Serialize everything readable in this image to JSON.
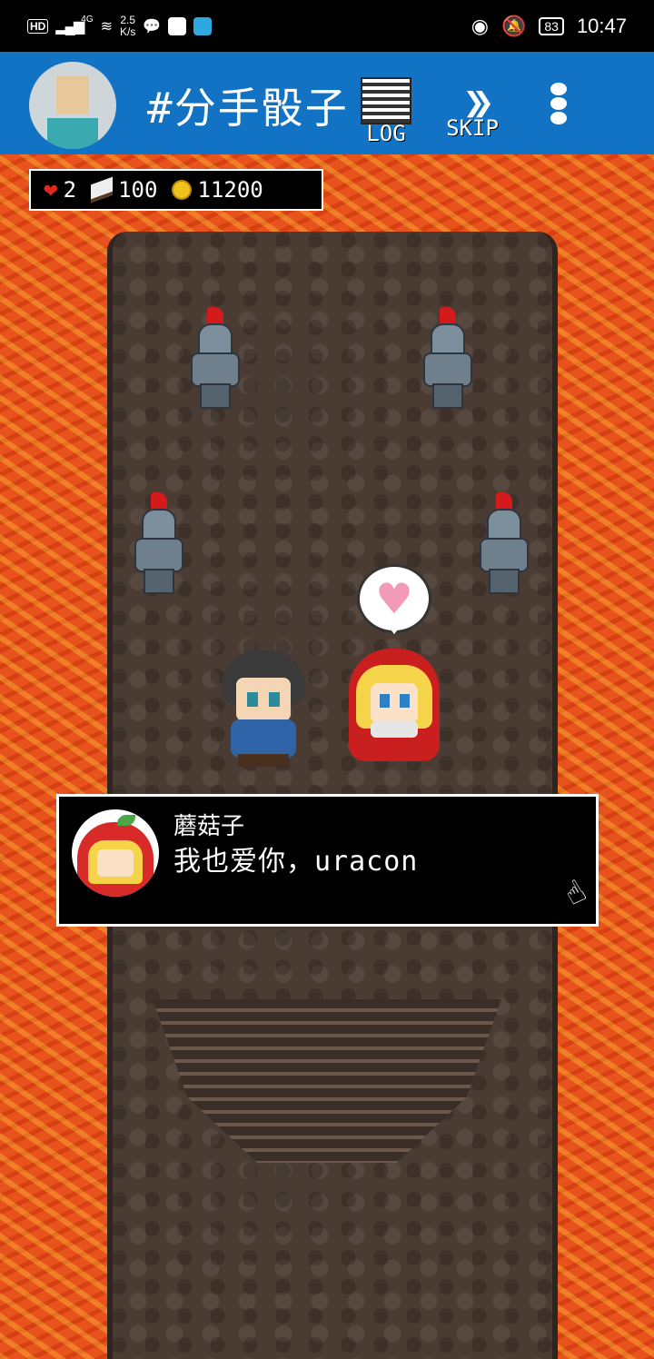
{
  "status_bar": {
    "hd": "HD",
    "network": "4G",
    "speed_value": "2.5",
    "speed_unit": "K/s",
    "battery": "83",
    "time": "10:47"
  },
  "header": {
    "title": "#分手骰子",
    "log_label": "LOG",
    "skip_label": "SKIP"
  },
  "stats": {
    "hearts": "2",
    "tickets": "100",
    "coins": "11200"
  },
  "dialog": {
    "speaker": "蘑菇子",
    "text": "我也爱你，uracon"
  },
  "colors": {
    "header_bg": "#1273c4",
    "lava": "#e8521c",
    "floor": "#4b3c33",
    "dialog_bg": "#000000"
  }
}
